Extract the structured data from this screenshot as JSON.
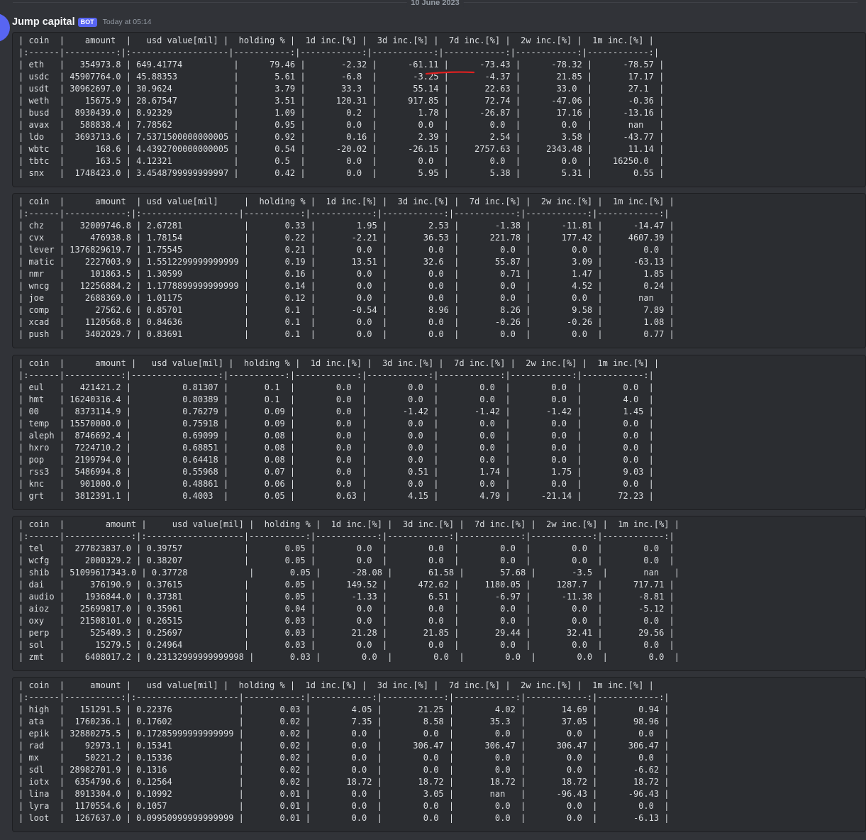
{
  "channel": {
    "date_divider": "10 June 2023"
  },
  "message": {
    "author": "Jump capital",
    "bot_tag": "BOT",
    "timestamp": "Today at 05:14"
  },
  "annotation": {
    "color": "#e02020"
  },
  "tables": [
    {
      "text": "| coin  |    amount  |   usd value[mil] |  holding % |  1d inc.[%] |  3d inc.[%] |  7d inc.[%] |  2w inc.[%] |  1m inc.[%] |\n|:------|----------:|:-------------------|-----------:|------------:|------------:|------------:|------------:|------------:|\n| eth   |   354973.8 | 649.41774          |      79.46 |       -2.32 |      -61.11 |      -73.43 |      -78.32 |      -78.57 |\n| usdc  | 45907764.0 | 45.88353           |       5.61 |       -6.8  |       -3.25 |       -4.37 |       21.85 |       17.17 |\n| usdt  | 30962697.0 | 30.9624            |       3.79 |       33.3  |       55.14 |       22.63 |       33.0  |       27.1  |\n| weth  |    15675.9 | 28.67547           |       3.51 |      120.31 |      917.85 |       72.74 |      -47.06 |       -0.36 |\n| busd  |  8930439.0 | 8.92329            |       1.09 |        0.2  |        1.78 |      -26.87 |       17.16 |      -13.16 |\n| avax  |   588838.4 | 7.78562            |       0.95 |        0.0  |        0.0  |        0.0  |        0.0  |       nan   |\n| ldo   |  3693713.6 | 7.5371500000000005 |       0.92 |        0.16 |        2.39 |        2.54 |        3.58 |      -43.77 |\n| wbtc  |      168.6 | 4.4392700000000005 |       0.54 |      -20.02 |      -26.15 |     2757.63 |     2343.48 |       11.14 |\n| tbtc  |      163.5 | 4.12321            |       0.5  |        0.0  |        0.0  |        0.0  |        0.0  |    16250.0  |\n| snx   |  1748423.0 | 3.4548799999999997 |       0.42 |        0.0  |        5.95 |        5.38 |        5.31 |        0.55 |"
    },
    {
      "text": "| coin  |      amount  | usd value[mil]     |  holding % |  1d inc.[%] |  3d inc.[%] |  7d inc.[%] |  2w inc.[%] |  1m inc.[%] |\n|:------|------------:|:-------------------|-----------:|------------:|------------:|------------:|------------:|------------:|\n| chz   |   32009746.8 | 2.67281            |       0.33 |        1.95 |        2.53 |       -1.38 |      -11.81 |      -14.47 |\n| cvx   |     476938.8 | 1.78154            |       0.22 |       -2.21 |       36.53 |      221.78 |      177.42 |     4607.39 |\n| lever | 1376829619.7 | 1.75545            |       0.21 |        0.0  |        0.0  |        0.0  |        0.0  |        0.0  |\n| matic |    2227003.9 | 1.5512299999999999 |       0.19 |       13.51 |       32.6  |       55.87 |        3.09 |      -63.13 |\n| nmr   |     101863.5 | 1.30599            |       0.16 |        0.0  |        0.0  |        0.71 |        1.47 |        1.85 |\n| wncg  |   12256884.2 | 1.1778899999999999 |       0.14 |        0.0  |        0.0  |        0.0  |        4.52 |        0.24 |\n| joe   |    2688369.0 | 1.01175            |       0.12 |        0.0  |        0.0  |        0.0  |        0.0  |       nan   |\n| comp  |      27562.6 | 0.85701            |       0.1  |       -0.54 |        8.96 |        8.26 |        9.58 |        7.89 |\n| xcad  |    1120568.8 | 0.84636            |       0.1  |        0.0  |        0.0  |       -0.26 |       -0.26 |        1.08 |\n| push  |    3402029.7 | 0.83691            |       0.1  |        0.0  |        0.0  |        0.0  |        0.0  |        0.77 |"
    },
    {
      "text": "| coin  |      amount |   usd value[mil] |  holding % |  1d inc.[%] |  3d inc.[%] |  7d inc.[%] |  2w inc.[%] |  1m inc.[%] |\n|:------|-----------:|-----------------:|-----------:|------------:|------------:|------------:|------------:|------------:|\n| eul   |   421421.2 |          0.81307 |       0.1  |        0.0  |        0.0  |        0.0  |        0.0  |        0.0  |\n| hmt   | 16240316.4 |          0.80389 |       0.1  |        0.0  |        0.0  |        0.0  |        0.0  |        4.0  |\n| 00    |  8373114.9 |          0.76279 |       0.09 |        0.0  |       -1.42 |       -1.42 |       -1.42 |        1.45 |\n| temp  | 15570000.0 |          0.75918 |       0.09 |        0.0  |        0.0  |        0.0  |        0.0  |        0.0  |\n| aleph |  8746692.4 |          0.69099 |       0.08 |        0.0  |        0.0  |        0.0  |        0.0  |        0.0  |\n| hxro  |  7224710.2 |          0.68851 |       0.08 |        0.0  |        0.0  |        0.0  |        0.0  |        0.0  |\n| pop   |  2199794.0 |          0.64418 |       0.08 |        0.0  |        0.0  |        0.0  |        0.0  |        0.0  |\n| rss3  |  5486994.8 |          0.55968 |       0.07 |        0.0  |        0.51 |        1.74 |        1.75 |        9.03 |\n| knc   |   901000.0 |          0.48861 |       0.06 |        0.0  |        0.0  |        0.0  |        0.0  |        0.0  |\n| grt   |  3812391.1 |          0.4003  |       0.05 |        0.63 |        4.15 |        4.79 |      -21.14 |       72.23 |"
    },
    {
      "text": "| coin  |        amount |     usd value[mil] |  holding % |  1d inc.[%] |  3d inc.[%] |  7d inc.[%] |  2w inc.[%] |  1m inc.[%] |\n|:------|-------------:|:-------------------|-----------:|------------:|------------:|------------:|------------:|------------:|\n| tel   |  277823837.0 | 0.39757            |       0.05 |        0.0  |        0.0  |        0.0  |        0.0  |        0.0  |\n| wcfg  |    2000329.2 | 0.38207            |       0.05 |        0.0  |        0.0  |        0.0  |        0.0  |        0.0  |\n| shib  | 51099617343.0 | 0.37728            |       0.05 |      -28.08 |       61.58 |       57.68 |       -3.5  |       nan   |\n| dai   |     376190.9 | 0.37615            |       0.05 |      149.52 |      472.62 |     1180.05 |     1287.7  |      717.71 |\n| audio |    1936844.0 | 0.37381            |       0.05 |       -1.33 |        6.51 |       -6.97 |      -11.38 |       -8.81 |\n| aioz  |   25699817.0 | 0.35961            |       0.04 |        0.0  |        0.0  |        0.0  |        0.0  |       -5.12 |\n| oxy   |   21508101.0 | 0.26515            |       0.03 |        0.0  |        0.0  |        0.0  |        0.0  |        0.0  |\n| perp  |     525489.3 | 0.25697            |       0.03 |       21.28 |       21.85 |       29.44 |       32.41 |       29.56 |\n| sol   |      15279.5 | 0.24964            |       0.03 |        0.0  |        0.0  |        0.0  |        0.0  |        0.0  |\n| zmt   |    6408017.2 | 0.23132999999999998 |       0.03 |        0.0  |        0.0  |        0.0  |        0.0  |        0.0  |"
    },
    {
      "text": "| coin  |     amount |   usd value[mil] |  holding % |  1d inc.[%] |  3d inc.[%] |  7d inc.[%] |  2w inc.[%] |  1m inc.[%] |\n|:------|-----------:|:--------------------|-----------:|------------:|------------:|------------:|------------:|------------:|\n| high  |   151291.5 | 0.22376             |       0.03 |        4.05 |       21.25 |        4.02 |       14.69 |        0.94 |\n| ata   |  1760236.1 | 0.17602             |       0.02 |        7.35 |        8.58 |       35.3  |       37.05 |       98.96 |\n| epik  | 32880275.5 | 0.17285999999999999 |       0.02 |        0.0  |        0.0  |        0.0  |        0.0  |        0.0  |\n| rad   |    92973.1 | 0.15341             |       0.02 |        0.0  |      306.47 |      306.47 |      306.47 |      306.47 |\n| mx    |    50221.2 | 0.15336             |       0.02 |        0.0  |        0.0  |        0.0  |        0.0  |        0.0  |\n| sdl   | 28982701.9 | 0.1316              |       0.02 |        0.0  |        0.0  |        0.0  |        0.0  |       -6.62 |\n| iotx  |  6354790.6 | 0.12564             |       0.02 |       18.72 |       18.72 |       18.72 |       18.72 |       18.72 |\n| lina  |  8913304.0 | 0.10992             |       0.01 |        0.0  |        3.05 |       nan   |      -96.43 |      -96.43 |\n| lyra  |  1170554.6 | 0.1057              |       0.01 |        0.0  |        0.0  |        0.0  |        0.0  |        0.0  |\n| loot  |  1267637.0 | 0.09950999999999999 |       0.01 |        0.0  |        0.0  |        0.0  |        0.0  |       -6.13 |"
    }
  ]
}
